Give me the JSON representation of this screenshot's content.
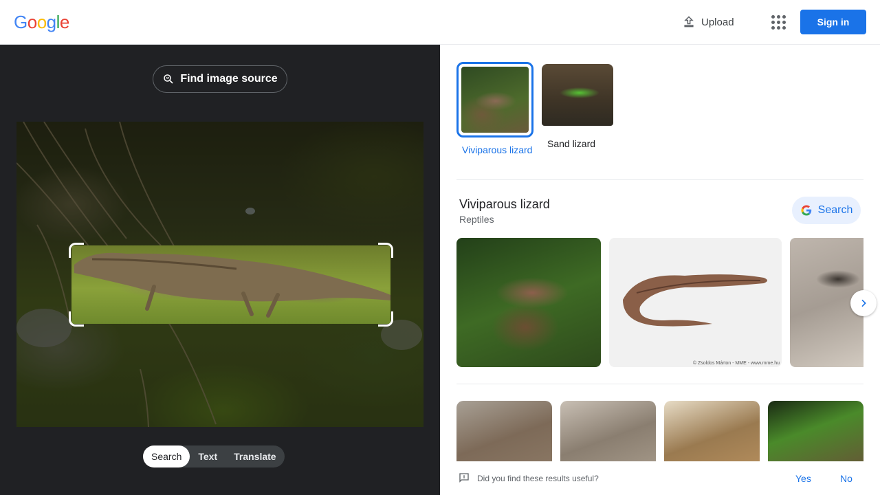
{
  "header": {
    "logo": [
      "G",
      "o",
      "o",
      "g",
      "l",
      "e"
    ],
    "upload_label": "Upload",
    "apps_icon": "apps-grid-icon",
    "signin_label": "Sign in"
  },
  "left": {
    "find_source_label": "Find image source",
    "modes": [
      {
        "label": "Search",
        "active": true
      },
      {
        "label": "Text",
        "active": false
      },
      {
        "label": "Translate",
        "active": false
      }
    ]
  },
  "right": {
    "chips": [
      {
        "label": "Viviparous lizard",
        "selected": true
      },
      {
        "label": "Sand lizard",
        "selected": false
      }
    ],
    "knowledge": {
      "title": "Viviparous lizard",
      "subtitle": "Reptiles",
      "search_label": "Search"
    },
    "image_credit": "© Zsoldos Márton - MME - www.mme.hu",
    "feedback": {
      "question": "Did you find these results useful?",
      "yes": "Yes",
      "no": "No"
    }
  },
  "colors": {
    "accent": "#1a73e8",
    "dark_bg": "#202124"
  }
}
